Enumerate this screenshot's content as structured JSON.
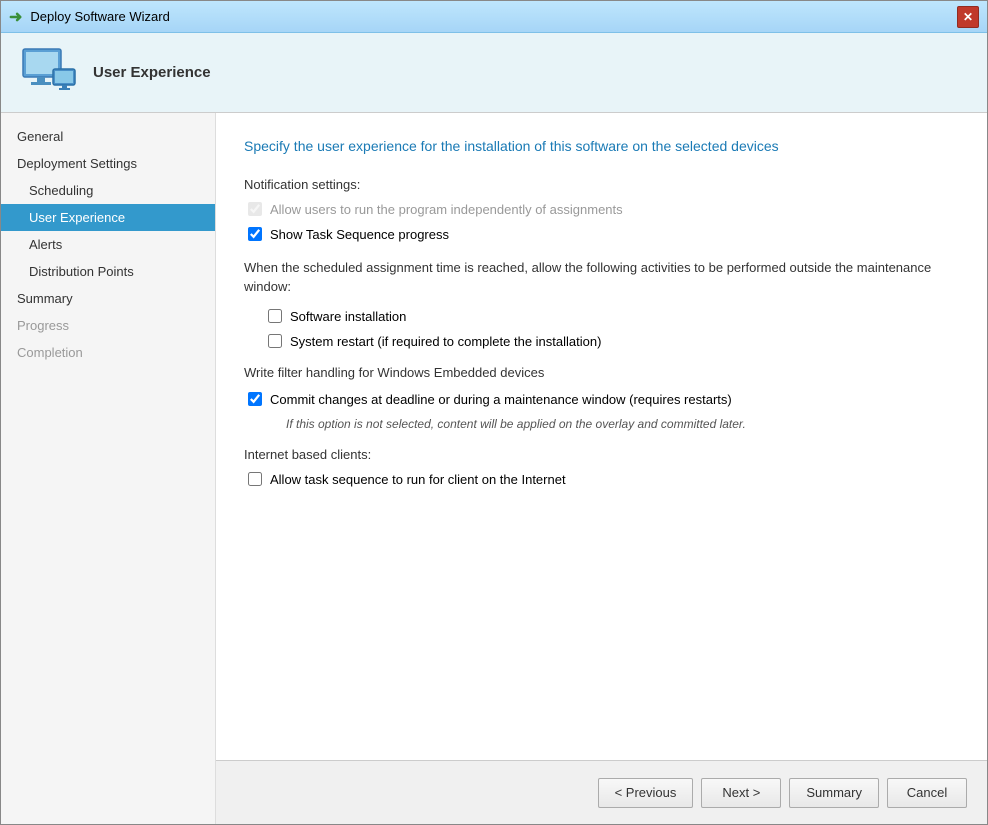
{
  "window": {
    "title": "Deploy Software Wizard",
    "close_label": "✕"
  },
  "header": {
    "title": "User Experience"
  },
  "sidebar": {
    "items": [
      {
        "id": "general",
        "label": "General",
        "indent": false,
        "active": false,
        "disabled": false
      },
      {
        "id": "deployment-settings",
        "label": "Deployment Settings",
        "indent": false,
        "active": false,
        "disabled": false
      },
      {
        "id": "scheduling",
        "label": "Scheduling",
        "indent": true,
        "active": false,
        "disabled": false
      },
      {
        "id": "user-experience",
        "label": "User Experience",
        "indent": true,
        "active": true,
        "disabled": false
      },
      {
        "id": "alerts",
        "label": "Alerts",
        "indent": true,
        "active": false,
        "disabled": false
      },
      {
        "id": "distribution-points",
        "label": "Distribution Points",
        "indent": true,
        "active": false,
        "disabled": false
      },
      {
        "id": "summary",
        "label": "Summary",
        "indent": false,
        "active": false,
        "disabled": false
      },
      {
        "id": "progress",
        "label": "Progress",
        "indent": false,
        "active": false,
        "disabled": true
      },
      {
        "id": "completion",
        "label": "Completion",
        "indent": false,
        "active": false,
        "disabled": true
      }
    ]
  },
  "content": {
    "title": "Specify the user experience for the installation of this software on the selected devices",
    "notification_label": "Notification settings:",
    "checkbox_allow_users": {
      "label": "Allow users to run the program independently of assignments",
      "checked": true,
      "disabled": true
    },
    "checkbox_show_progress": {
      "label": "Show Task Sequence progress",
      "checked": true,
      "disabled": false
    },
    "maintenance_text": "When the scheduled assignment time is reached, allow the following activities to be performed outside the maintenance window:",
    "checkbox_software_install": {
      "label": "Software installation",
      "checked": false,
      "disabled": false
    },
    "checkbox_system_restart": {
      "label": "System restart (if required to complete the installation)",
      "checked": false,
      "disabled": false
    },
    "write_filter_label": "Write filter handling for Windows Embedded devices",
    "checkbox_commit_changes": {
      "label": "Commit changes at deadline or during a maintenance window (requires restarts)",
      "checked": true,
      "disabled": false
    },
    "commit_note": "If this option is not selected, content will be applied on the overlay and committed later.",
    "internet_label": "Internet based clients:",
    "checkbox_internet": {
      "label": "Allow task sequence to run for client on the Internet",
      "checked": false,
      "disabled": false
    }
  },
  "footer": {
    "previous_label": "< Previous",
    "next_label": "Next >",
    "summary_label": "Summary",
    "cancel_label": "Cancel"
  },
  "title_arrow": "➜"
}
